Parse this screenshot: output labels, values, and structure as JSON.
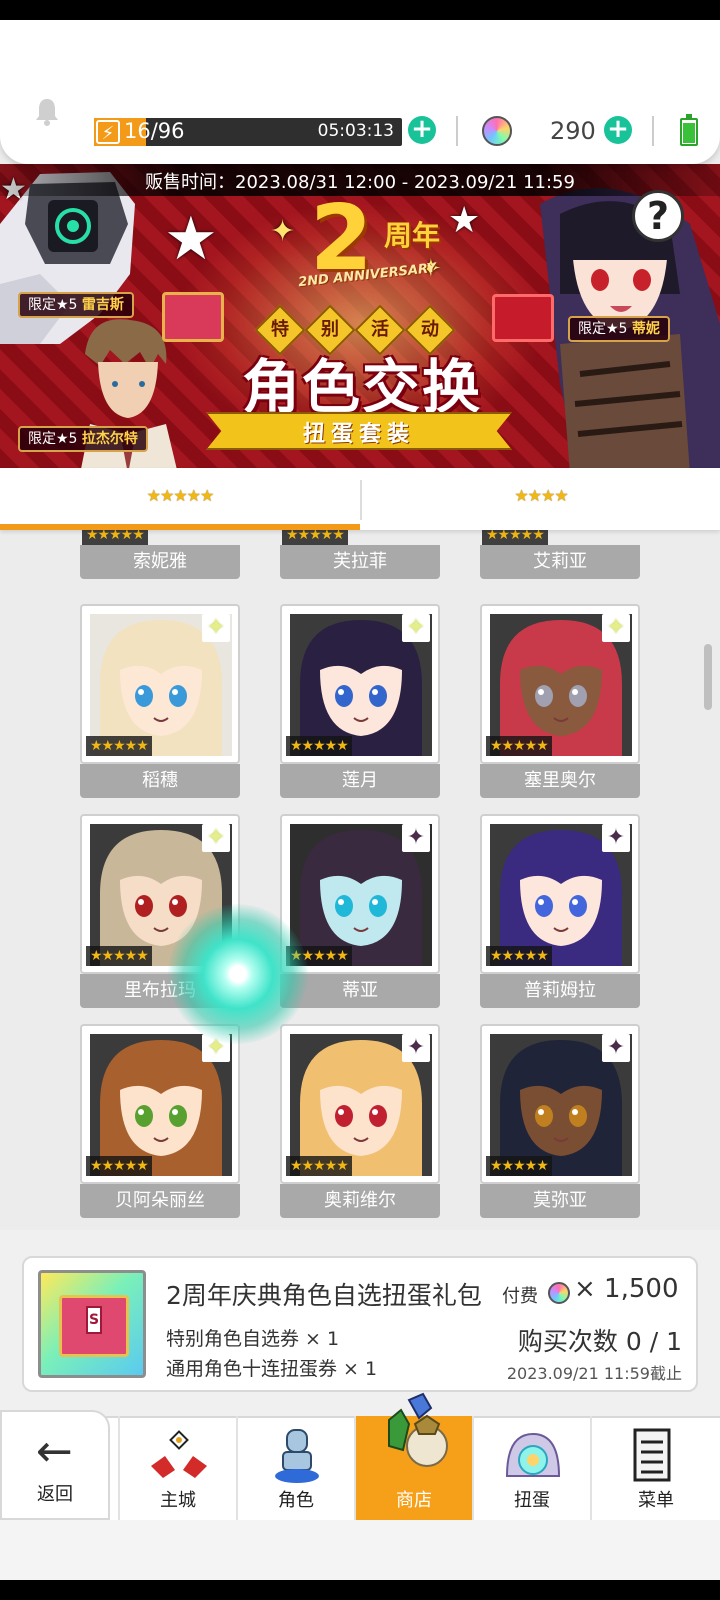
{
  "header": {
    "stamina_value": "16/96",
    "stamina_fill_fraction": 0.1667,
    "stamina_timer": "05:03:13",
    "gem_count": "290",
    "icons": [
      "bell-icon",
      "lightning-icon",
      "add-stamina-icon",
      "gem-icon",
      "add-gem-icon",
      "battery-icon"
    ]
  },
  "banner": {
    "sale_time": "贩售时间：2023.08/31 12:00 - 2023.09/21 11:59",
    "anniversary_number": "2",
    "anniversary_text": "周年",
    "anniversary_sub": "2ND ANNIVERSARY",
    "special_event_chars": [
      "特",
      "别",
      "活",
      "动"
    ],
    "title": "角色交换",
    "subtitle": "扭蛋套装",
    "tag_reiji": {
      "prefix": "限定★5",
      "name": "雷吉斯"
    },
    "tag_razel": {
      "prefix": "限定★5",
      "name": "拉杰尔特"
    },
    "tag_tini": {
      "prefix": "限定★5",
      "name": "蒂妮"
    },
    "help_label": "?"
  },
  "tabs": [
    {
      "stars": "★★★★★",
      "rarity": 5,
      "active": true
    },
    {
      "stars": "★★★★",
      "rarity": 4,
      "active": false
    }
  ],
  "characters": {
    "row0": [
      {
        "name": "索妮雅",
        "stars": "★★★★★"
      },
      {
        "name": "芙拉菲",
        "stars": "★★★★★"
      },
      {
        "name": "艾莉亚",
        "stars": "★★★★★"
      }
    ],
    "row1": [
      {
        "name": "稻穗",
        "stars": "★★★★★",
        "badge": "✦",
        "hair": "#f2e2c0",
        "skin": "#fde8d6",
        "eyes": "#3a9ad9",
        "bg": "#e9e6e0"
      },
      {
        "name": "莲月",
        "stars": "★★★★★",
        "badge": "✦",
        "hair": "#2a2042",
        "skin": "#fde6dc",
        "eyes": "#3366cc",
        "bg": "#3b3b3b"
      },
      {
        "name": "塞里奥尔",
        "stars": "★★★★★",
        "badge": "✦",
        "hair": "#c83a4a",
        "skin": "#8a5a3e",
        "eyes": "#a0a0b0",
        "bg": "#3b3b3b"
      }
    ],
    "row2": [
      {
        "name": "里布拉玛",
        "stars": "★★★★★",
        "badge": "✦",
        "hair": "#c9b79a",
        "skin": "#f5ddc8",
        "eyes": "#b02020",
        "bg": "#3b3b3b"
      },
      {
        "name": "蒂亚",
        "stars": "★★★★★",
        "badge": "✦",
        "hair": "#3a2a40",
        "skin": "#bfe9ee",
        "eyes": "#20b8d8",
        "bg": "#2e2e2e"
      },
      {
        "name": "普莉姆拉",
        "stars": "★★★★★",
        "badge": "✦",
        "hair": "#3a2a80",
        "skin": "#fde6dc",
        "eyes": "#4466dd",
        "bg": "#3b3b3b"
      }
    ],
    "row3": [
      {
        "name": "贝阿朵丽丝",
        "stars": "★★★★★",
        "badge": "✦",
        "hair": "#a8602e",
        "skin": "#fde2cc",
        "eyes": "#58a030",
        "bg": "#3b3b3b"
      },
      {
        "name": "奥莉维尔",
        "stars": "★★★★★",
        "badge": "✦",
        "hair": "#f0c070",
        "skin": "#fde2cc",
        "eyes": "#c02030",
        "bg": "#3b3b3b"
      },
      {
        "name": "莫弥亚",
        "stars": "★★★★★",
        "badge": "✦",
        "hair": "#202438",
        "skin": "#7a4e32",
        "eyes": "#c08020",
        "bg": "#3b3b3b"
      }
    ]
  },
  "package": {
    "title": "2周年庆典角色自选扭蛋礼包",
    "pay_label": "付费",
    "price": "× 1,500",
    "item1": "特别角色自选券 × 1",
    "item2": "通用角色十连扭蛋券 × 1",
    "purchase_count": "购买次数 0 / 1",
    "deadline": "2023.09/21 11:59截止",
    "icon_letter": "S"
  },
  "nav": {
    "back": "返回",
    "items": [
      {
        "label": "主城",
        "icon": "castle-icon",
        "active": false
      },
      {
        "label": "角色",
        "icon": "character-icon",
        "active": false
      },
      {
        "label": "商店",
        "icon": "shop-icon",
        "active": true
      },
      {
        "label": "扭蛋",
        "icon": "gacha-icon",
        "active": false
      },
      {
        "label": "菜单",
        "icon": "menu-icon",
        "active": false
      }
    ]
  },
  "colors": {
    "accent_orange": "#f39a18",
    "plus_green": "#19c39a",
    "banner_red": "#a3151f",
    "star_gold": "#f1b814"
  }
}
